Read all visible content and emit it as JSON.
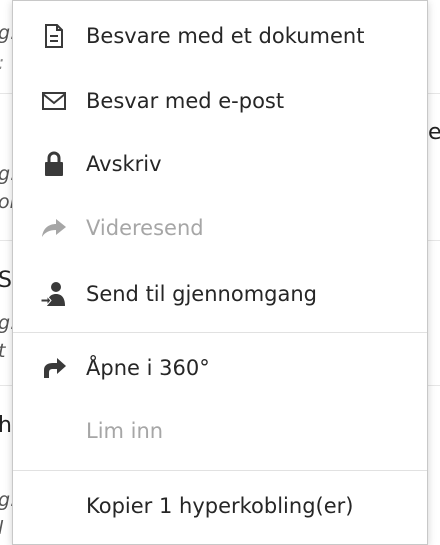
{
  "menu": {
    "items": [
      {
        "id": "reply-document",
        "label": "Besvare med et dokument",
        "icon": "document-icon",
        "enabled": true
      },
      {
        "id": "reply-email",
        "label": "Besvar med e-post",
        "icon": "envelope-icon",
        "enabled": true
      },
      {
        "id": "write-off",
        "label": "Avskriv",
        "icon": "lock-icon",
        "enabled": true
      },
      {
        "id": "forward",
        "label": "Videresend",
        "icon": "forward-arrow-icon",
        "enabled": false
      },
      {
        "id": "send-for-review",
        "label": "Send til gjennomgang",
        "icon": "person-arrow-icon",
        "enabled": true
      },
      {
        "id": "open-360",
        "label": "Åpne i 360°",
        "icon": "redo-arrow-icon",
        "enabled": true
      },
      {
        "id": "paste",
        "label": "Lim inn",
        "icon": "",
        "enabled": false
      },
      {
        "id": "copy-hyperlinks",
        "label": "Kopier 1 hyperkobling(er)",
        "icon": "",
        "enabled": true
      }
    ]
  },
  "background": {
    "fragments": [
      "g.",
      ":",
      "g.",
      "oi",
      "S",
      "g.",
      "t",
      "h",
      "g.",
      "l"
    ],
    "right_fragments": [
      "e"
    ]
  },
  "colors": {
    "text": "#262626",
    "disabled_text": "#a6a6a6",
    "icon": "#3a3a3a",
    "disabled_icon": "#a6a6a6",
    "separator": "#e1e1e1"
  }
}
